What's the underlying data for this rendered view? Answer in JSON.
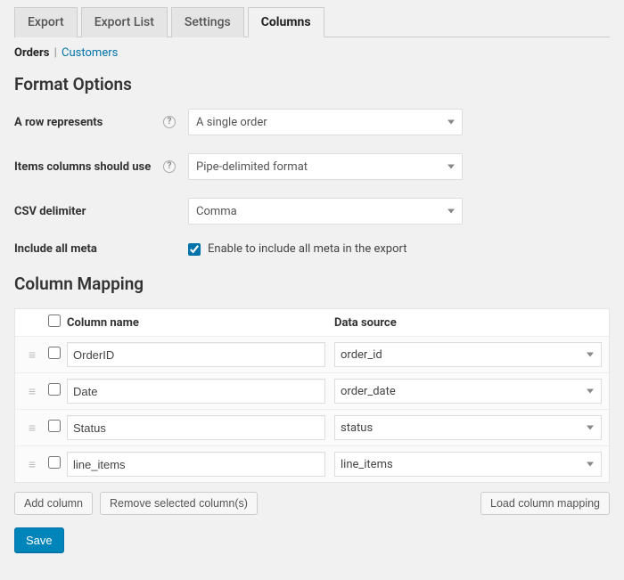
{
  "tabs": [
    {
      "label": "Export",
      "active": false
    },
    {
      "label": "Export List",
      "active": false
    },
    {
      "label": "Settings",
      "active": false
    },
    {
      "label": "Columns",
      "active": true
    }
  ],
  "subnav": {
    "active": "Orders",
    "link": "Customers"
  },
  "sections": {
    "format_options": "Format Options",
    "column_mapping": "Column Mapping"
  },
  "form": {
    "row_represents": {
      "label": "A row represents",
      "value": "A single order"
    },
    "items_columns": {
      "label": "Items columns should use",
      "value": "Pipe-delimited format"
    },
    "csv_delimiter": {
      "label": "CSV delimiter",
      "value": "Comma"
    },
    "include_meta": {
      "label": "Include all meta",
      "checkbox_label": "Enable to include all meta in the export",
      "checked": true
    }
  },
  "table": {
    "headers": {
      "name": "Column name",
      "source": "Data source"
    },
    "rows": [
      {
        "name": "OrderID",
        "source": "order_id"
      },
      {
        "name": "Date",
        "source": "order_date"
      },
      {
        "name": "Status",
        "source": "status"
      },
      {
        "name": "line_items",
        "source": "line_items"
      }
    ]
  },
  "buttons": {
    "add_column": "Add column",
    "remove_selected": "Remove selected column(s)",
    "load_mapping": "Load column mapping",
    "save": "Save"
  }
}
